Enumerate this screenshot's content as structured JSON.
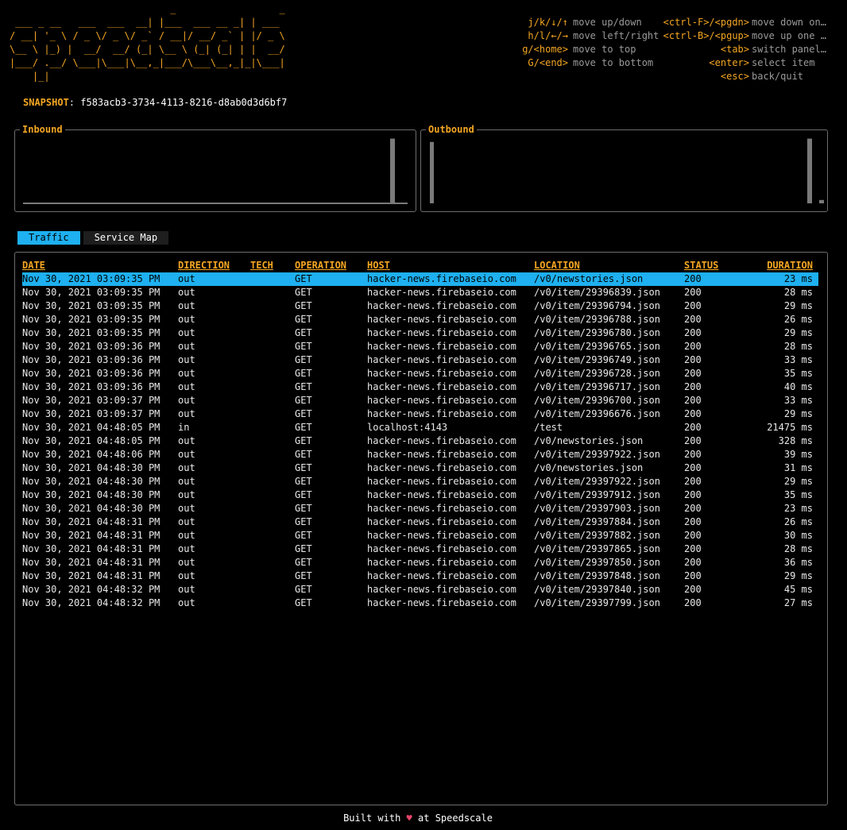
{
  "logo_ascii": "                            _                  _\n ___ _ __   ___  ___  __| |___  ___ __ _| | ___\n/ __| '_ \\ / _ \\/ _ \\/ _` / __|/ __/ _` | |/ _ \\\n\\__ \\ |_) |  __/  __/ (_| \\__ \\ (_| (_| | |  __/\n|___/ .__/ \\___|\\___|\\__,_|___/\\___\\__,_|_|\\___|\n    |_|",
  "keybindings": [
    {
      "key": "j/k/↓/↑",
      "desc": "move up/down",
      "key2": "<ctrl-F>/<pgdn>",
      "desc2": "move down one…"
    },
    {
      "key": "h/l/←/→",
      "desc": "move left/right",
      "key2": "<ctrl-B>/<pgup>",
      "desc2": "move up one p…"
    },
    {
      "key": "g/<home>",
      "desc": "move to top",
      "key2": "<tab>",
      "desc2": "switch panel …"
    },
    {
      "key": "G/<end>",
      "desc": "move to bottom",
      "key2": "<enter>",
      "desc2": "select item"
    },
    {
      "key": "",
      "desc": "",
      "key2": "<esc>",
      "desc2": "back/quit"
    }
  ],
  "snapshot": {
    "label": "SNAPSHOT",
    "id": "f583acb3-3734-4113-8216-d8ab0d3d6bf7"
  },
  "inbound": {
    "title": "Inbound",
    "bars": [
      0.0,
      0.97
    ]
  },
  "outbound": {
    "title": "Outbound",
    "bars": [
      0.92,
      0.97,
      0.05
    ]
  },
  "tabs": [
    {
      "label": "Traffic",
      "active": true
    },
    {
      "label": "Service Map",
      "active": false
    }
  ],
  "columns": [
    "DATE",
    "DIRECTION",
    "TECH",
    "OPERATION",
    "HOST",
    "LOCATION",
    "STATUS",
    "DURATION"
  ],
  "rows": [
    [
      "Nov 30, 2021 03:09:35 PM",
      "out",
      "",
      "GET",
      "hacker-news.firebaseio.com",
      "/v0/newstories.json",
      "200",
      "23 ms"
    ],
    [
      "Nov 30, 2021 03:09:35 PM",
      "out",
      "",
      "GET",
      "hacker-news.firebaseio.com",
      "/v0/item/29396839.json",
      "200",
      "28 ms"
    ],
    [
      "Nov 30, 2021 03:09:35 PM",
      "out",
      "",
      "GET",
      "hacker-news.firebaseio.com",
      "/v0/item/29396794.json",
      "200",
      "29 ms"
    ],
    [
      "Nov 30, 2021 03:09:35 PM",
      "out",
      "",
      "GET",
      "hacker-news.firebaseio.com",
      "/v0/item/29396788.json",
      "200",
      "26 ms"
    ],
    [
      "Nov 30, 2021 03:09:35 PM",
      "out",
      "",
      "GET",
      "hacker-news.firebaseio.com",
      "/v0/item/29396780.json",
      "200",
      "29 ms"
    ],
    [
      "Nov 30, 2021 03:09:36 PM",
      "out",
      "",
      "GET",
      "hacker-news.firebaseio.com",
      "/v0/item/29396765.json",
      "200",
      "28 ms"
    ],
    [
      "Nov 30, 2021 03:09:36 PM",
      "out",
      "",
      "GET",
      "hacker-news.firebaseio.com",
      "/v0/item/29396749.json",
      "200",
      "33 ms"
    ],
    [
      "Nov 30, 2021 03:09:36 PM",
      "out",
      "",
      "GET",
      "hacker-news.firebaseio.com",
      "/v0/item/29396728.json",
      "200",
      "35 ms"
    ],
    [
      "Nov 30, 2021 03:09:36 PM",
      "out",
      "",
      "GET",
      "hacker-news.firebaseio.com",
      "/v0/item/29396717.json",
      "200",
      "40 ms"
    ],
    [
      "Nov 30, 2021 03:09:37 PM",
      "out",
      "",
      "GET",
      "hacker-news.firebaseio.com",
      "/v0/item/29396700.json",
      "200",
      "33 ms"
    ],
    [
      "Nov 30, 2021 03:09:37 PM",
      "out",
      "",
      "GET",
      "hacker-news.firebaseio.com",
      "/v0/item/29396676.json",
      "200",
      "29 ms"
    ],
    [
      "Nov 30, 2021 04:48:05 PM",
      "in",
      "",
      "GET",
      "localhost:4143",
      "/test",
      "200",
      "21475 ms"
    ],
    [
      "Nov 30, 2021 04:48:05 PM",
      "out",
      "",
      "GET",
      "hacker-news.firebaseio.com",
      "/v0/newstories.json",
      "200",
      "328 ms"
    ],
    [
      "Nov 30, 2021 04:48:06 PM",
      "out",
      "",
      "GET",
      "hacker-news.firebaseio.com",
      "/v0/item/29397922.json",
      "200",
      "39 ms"
    ],
    [
      "Nov 30, 2021 04:48:30 PM",
      "out",
      "",
      "GET",
      "hacker-news.firebaseio.com",
      "/v0/newstories.json",
      "200",
      "31 ms"
    ],
    [
      "Nov 30, 2021 04:48:30 PM",
      "out",
      "",
      "GET",
      "hacker-news.firebaseio.com",
      "/v0/item/29397922.json",
      "200",
      "29 ms"
    ],
    [
      "Nov 30, 2021 04:48:30 PM",
      "out",
      "",
      "GET",
      "hacker-news.firebaseio.com",
      "/v0/item/29397912.json",
      "200",
      "35 ms"
    ],
    [
      "Nov 30, 2021 04:48:30 PM",
      "out",
      "",
      "GET",
      "hacker-news.firebaseio.com",
      "/v0/item/29397903.json",
      "200",
      "23 ms"
    ],
    [
      "Nov 30, 2021 04:48:31 PM",
      "out",
      "",
      "GET",
      "hacker-news.firebaseio.com",
      "/v0/item/29397884.json",
      "200",
      "26 ms"
    ],
    [
      "Nov 30, 2021 04:48:31 PM",
      "out",
      "",
      "GET",
      "hacker-news.firebaseio.com",
      "/v0/item/29397882.json",
      "200",
      "30 ms"
    ],
    [
      "Nov 30, 2021 04:48:31 PM",
      "out",
      "",
      "GET",
      "hacker-news.firebaseio.com",
      "/v0/item/29397865.json",
      "200",
      "28 ms"
    ],
    [
      "Nov 30, 2021 04:48:31 PM",
      "out",
      "",
      "GET",
      "hacker-news.firebaseio.com",
      "/v0/item/29397850.json",
      "200",
      "36 ms"
    ],
    [
      "Nov 30, 2021 04:48:31 PM",
      "out",
      "",
      "GET",
      "hacker-news.firebaseio.com",
      "/v0/item/29397848.json",
      "200",
      "29 ms"
    ],
    [
      "Nov 30, 2021 04:48:32 PM",
      "out",
      "",
      "GET",
      "hacker-news.firebaseio.com",
      "/v0/item/29397840.json",
      "200",
      "45 ms"
    ],
    [
      "Nov 30, 2021 04:48:32 PM",
      "out",
      "",
      "GET",
      "hacker-news.firebaseio.com",
      "/v0/item/29397799.json",
      "200",
      "27 ms"
    ]
  ],
  "selected_row": 0,
  "footer": {
    "prefix": "Built with",
    "heart": "♥",
    "suffix": "at Speedscale"
  },
  "colors": {
    "accent": "#f5a623",
    "selection": "#1eb0f0",
    "heart": "#e8456b"
  }
}
